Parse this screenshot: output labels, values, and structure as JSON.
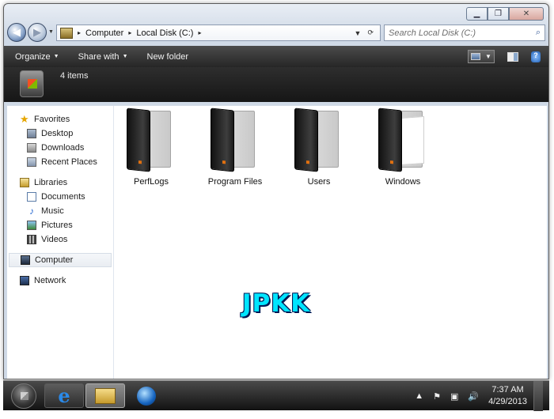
{
  "window": {
    "caption_buttons": {
      "minimize": "▁",
      "maximize": "❐",
      "close": "✕"
    }
  },
  "navigation": {
    "back_glyph": "◀",
    "forward_glyph": "▶",
    "history_dropdown": "▼",
    "breadcrumbs": [
      "Computer",
      "Local Disk (C:)"
    ],
    "crumb_separator": "▸",
    "address_dropdown": "▼",
    "refresh_glyph": "⟳"
  },
  "search": {
    "placeholder": "Search Local Disk (C:)",
    "icon": "search-icon"
  },
  "command_bar": {
    "organize": "Organize",
    "share_with": "Share with",
    "new_folder": "New folder",
    "dropdown_arrow": "▼",
    "help_glyph": "?"
  },
  "details": {
    "item_count": "4 items"
  },
  "sidebar": {
    "favorites_header": "Favorites",
    "favorites": [
      "Desktop",
      "Downloads",
      "Recent Places"
    ],
    "libraries_header": "Libraries",
    "libraries": [
      "Documents",
      "Music",
      "Pictures",
      "Videos"
    ],
    "computer": "Computer",
    "network": "Network",
    "star_glyph": "★",
    "music_glyph": "♪"
  },
  "files": [
    {
      "name": "PerfLogs"
    },
    {
      "name": "Program Files"
    },
    {
      "name": "Users"
    },
    {
      "name": "Windows"
    }
  ],
  "watermark": "JPKK",
  "taskbar": {
    "ie_glyph": "e",
    "tray_up": "▲",
    "tray_flag": "⚑",
    "tray_volume": "🔊",
    "tray_network": "▣",
    "time": "7:37 AM",
    "date": "4/29/2013"
  },
  "colors": {
    "command_bar": "#2e2e2e",
    "watermark": "#00e5ff",
    "accent": "#1f5fb5"
  }
}
